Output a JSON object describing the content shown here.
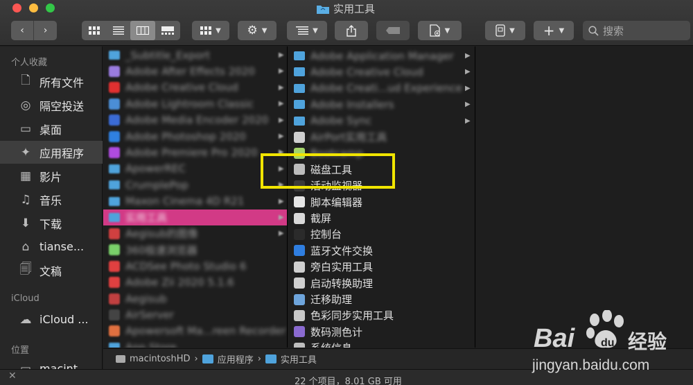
{
  "window": {
    "title": "实用工具"
  },
  "toolbar": {
    "search_placeholder": "搜索"
  },
  "sidebar": {
    "favorites_header": "个人收藏",
    "items": [
      {
        "label": "所有文件",
        "icon": "document-icon"
      },
      {
        "label": "隔空投送",
        "icon": "airdrop-icon"
      },
      {
        "label": "桌面",
        "icon": "desktop-icon"
      },
      {
        "label": "应用程序",
        "icon": "applications-icon"
      },
      {
        "label": "影片",
        "icon": "film-icon"
      },
      {
        "label": "音乐",
        "icon": "music-icon"
      },
      {
        "label": "下载",
        "icon": "download-icon"
      },
      {
        "label": "tianse...",
        "icon": "home-icon"
      },
      {
        "label": "文稿",
        "icon": "documents-icon"
      }
    ],
    "icloud_header": "iCloud",
    "icloud_items": [
      {
        "label": "iCloud ...",
        "icon": "cloud-icon"
      }
    ],
    "locations_header": "位置",
    "location_items": [
      {
        "label": "macint...",
        "icon": "disk-icon"
      }
    ]
  },
  "column1": {
    "items": [
      {
        "label": "_Subtitle_Export",
        "color": "#4fa3dc"
      },
      {
        "label": "Adobe After Effects 2020",
        "color": "#9a7ce0"
      },
      {
        "label": "Adobe Creative Cloud",
        "color": "#e03030"
      },
      {
        "label": "Adobe Lightroom Classic",
        "color": "#4b8ed6"
      },
      {
        "label": "Adobe Media Encoder 2020",
        "color": "#3b6bd6"
      },
      {
        "label": "Adobe Photoshop 2020",
        "color": "#2f80e0"
      },
      {
        "label": "Adobe Premiere Pro 2020",
        "color": "#b04be0"
      },
      {
        "label": "ApowerREC",
        "color": "#4fa3dc"
      },
      {
        "label": "CrumplePop",
        "color": "#4fa3dc"
      },
      {
        "label": "Maxon Cinema 4D R21",
        "color": "#4fa3dc"
      },
      {
        "label": "实用工具",
        "color": "#4fa3dc"
      },
      {
        "label": "Aegisub的图像",
        "color": "#d04040"
      },
      {
        "label": "360极速浏览器",
        "color": "#7ad06a"
      },
      {
        "label": "ACDSee Photo Studio 6",
        "color": "#e04040"
      },
      {
        "label": "Adobe Zii 2020 5.1.6",
        "color": "#e04040"
      },
      {
        "label": "Aegisub",
        "color": "#c04040"
      },
      {
        "label": "AirServer",
        "color": "#444444"
      },
      {
        "label": "Apowersoft Ma...reen Recorder",
        "color": "#e07040"
      },
      {
        "label": "App Store",
        "color": "#4fa3dc"
      }
    ]
  },
  "column2": {
    "items": [
      {
        "label": "Adobe Application Manager"
      },
      {
        "label": "Adobe Creative Cloud"
      },
      {
        "label": "Adobe Creati...ud Experience"
      },
      {
        "label": "Adobe Installers"
      },
      {
        "label": "Adobe Sync"
      },
      {
        "label": "AirPort实用工具"
      },
      {
        "label": "Bootcamp"
      },
      {
        "label": "磁盘工具"
      },
      {
        "label": "活动监视器"
      },
      {
        "label": "脚本编辑器"
      },
      {
        "label": "截屏"
      },
      {
        "label": "控制台"
      },
      {
        "label": "蓝牙文件交换"
      },
      {
        "label": "旁白实用工具"
      },
      {
        "label": "启动转换助理"
      },
      {
        "label": "迁移助理"
      },
      {
        "label": "色彩同步实用工具"
      },
      {
        "label": "数码测色计"
      },
      {
        "label": "系统信息"
      }
    ]
  },
  "pathbar": {
    "crumbs": [
      "macintoshHD",
      "应用程序",
      "实用工具"
    ]
  },
  "statusbar": {
    "text": "22 个项目，8.01 GB 可用"
  },
  "watermark": {
    "brand_left": "Bai",
    "brand_right": "经验",
    "url": "jingyan.baidu.com"
  },
  "colors": {
    "highlight": "#f0e400",
    "selection": "#d23a86",
    "folder": "#4fa3dc"
  }
}
